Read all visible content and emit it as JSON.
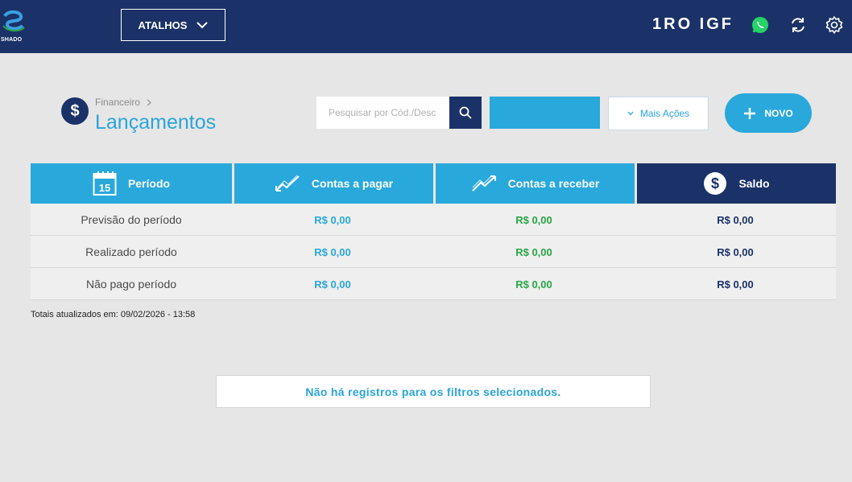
{
  "topbar": {
    "logo_text": "SHADO",
    "shortcuts_label": "ATALHOS",
    "company_name": "1RO IGF",
    "icons": [
      "whatsapp-icon",
      "refresh-icon",
      "gear-icon"
    ],
    "bg_color": "#1b3268"
  },
  "header": {
    "breadcrumb": "Financeiro",
    "title": "Lançamentos",
    "page_icon": "$",
    "search_placeholder": "Pesquisar por Cód./Desc",
    "more_actions_label": "Mais Ações",
    "new_label": "NOVO",
    "accent_color": "#29a8db"
  },
  "summary": {
    "columns": [
      {
        "label": "Período",
        "icon": "calendar-icon",
        "calendar_day": "15"
      },
      {
        "label": "Contas a pagar",
        "icon": "trend-down-icon"
      },
      {
        "label": "Contas a receber",
        "icon": "trend-up-icon"
      },
      {
        "label": "Saldo",
        "icon": "dollar-icon"
      }
    ],
    "rows": [
      {
        "label": "Previsão do período",
        "pagar": "R$ 0,00",
        "receber": "R$ 0,00",
        "saldo": "R$ 0,00"
      },
      {
        "label": "Realizado período",
        "pagar": "R$ 0,00",
        "receber": "R$ 0,00",
        "saldo": "R$ 0,00"
      },
      {
        "label": "Não pago período",
        "pagar": "R$ 0,00",
        "receber": "R$ 0,00",
        "saldo": "R$ 0,00"
      }
    ],
    "updated_text": "Totais atualizados em: 09/02/2026 - 13:58"
  },
  "empty_message": "Não há registros para os filtros selecionados."
}
